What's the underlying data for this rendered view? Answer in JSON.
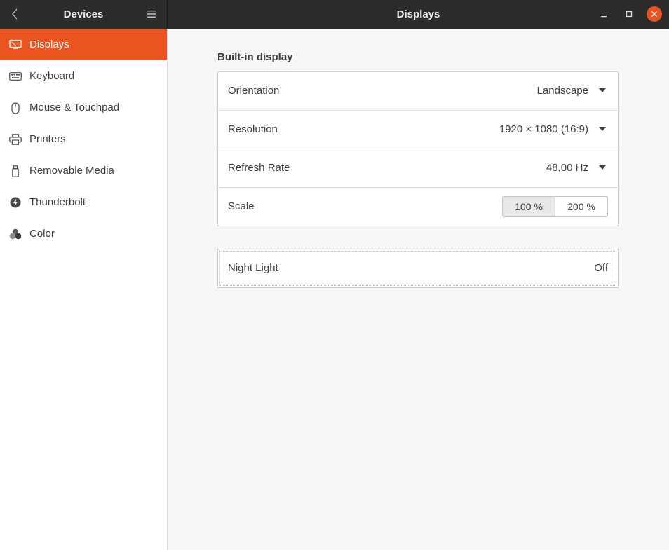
{
  "header": {
    "sidebar_title": "Devices",
    "main_title": "Displays"
  },
  "sidebar": {
    "items": [
      {
        "label": "Displays",
        "icon": "monitor-icon",
        "active": true
      },
      {
        "label": "Keyboard",
        "icon": "keyboard-icon",
        "active": false
      },
      {
        "label": "Mouse & Touchpad",
        "icon": "mouse-icon",
        "active": false
      },
      {
        "label": "Printers",
        "icon": "printer-icon",
        "active": false
      },
      {
        "label": "Removable Media",
        "icon": "usb-drive-icon",
        "active": false
      },
      {
        "label": "Thunderbolt",
        "icon": "thunderbolt-icon",
        "active": false
      },
      {
        "label": "Color",
        "icon": "color-icon",
        "active": false
      }
    ]
  },
  "main": {
    "section_title": "Built-in display",
    "rows": {
      "orientation": {
        "label": "Orientation",
        "value": "Landscape"
      },
      "resolution": {
        "label": "Resolution",
        "value": "1920 × 1080 (16:9)"
      },
      "refresh_rate": {
        "label": "Refresh Rate",
        "value": "48,00 Hz"
      },
      "scale": {
        "label": "Scale",
        "options": [
          "100 %",
          "200 %"
        ],
        "selected": "100 %"
      }
    },
    "night_light": {
      "label": "Night Light",
      "value": "Off"
    }
  },
  "colors": {
    "accent": "#e95420",
    "headerbar": "#2c2c2c",
    "content_bg": "#f6f6f6"
  }
}
